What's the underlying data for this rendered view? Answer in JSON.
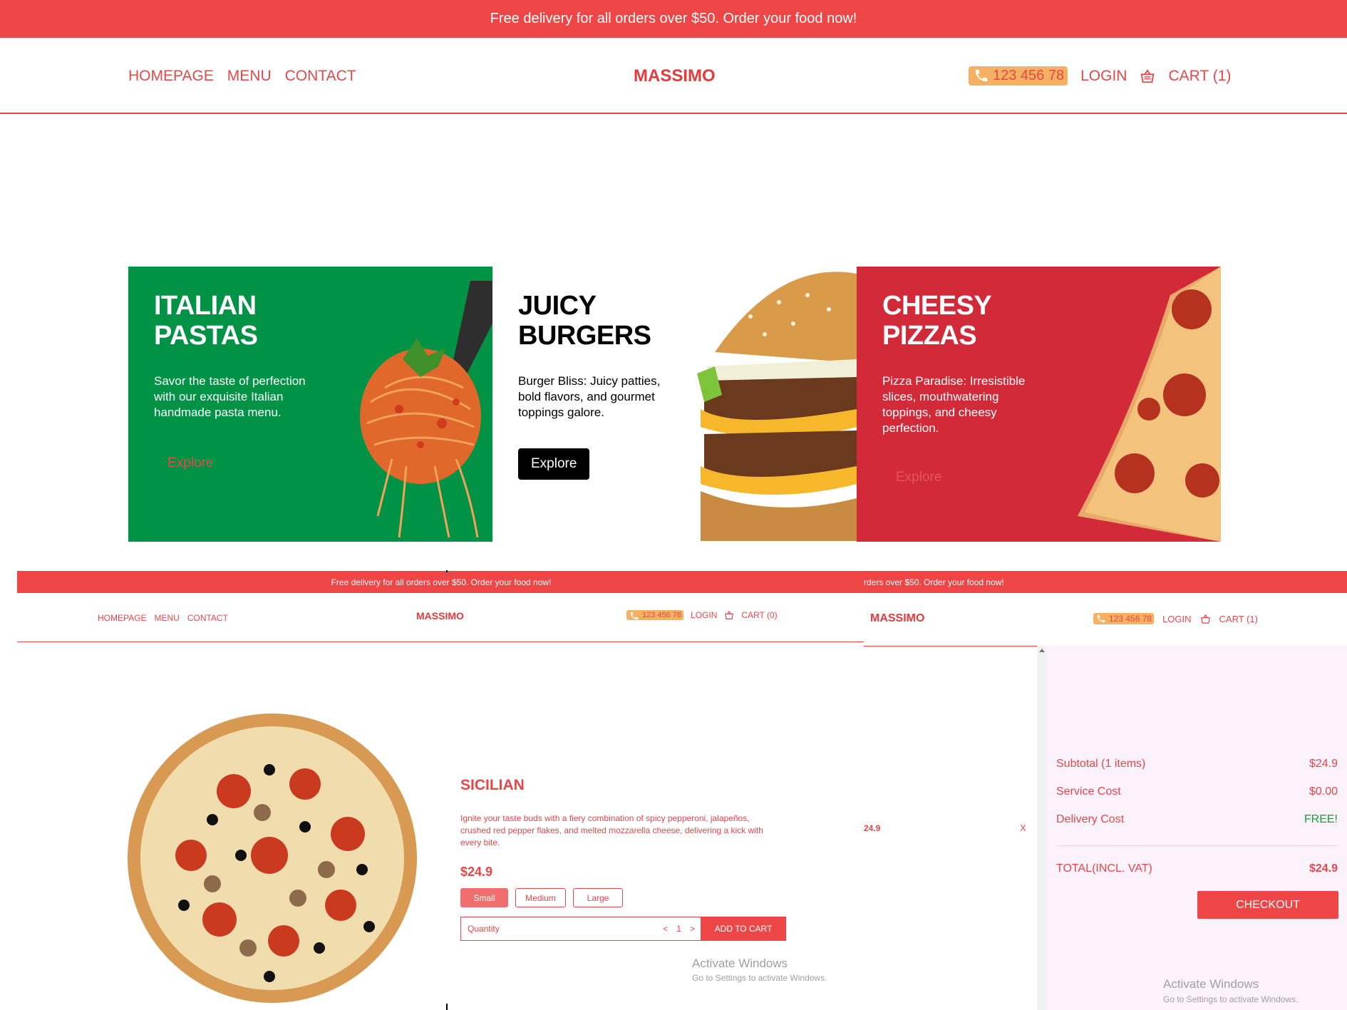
{
  "promo": {
    "text": "Free delivery for all orders over $50. Order your food now!"
  },
  "header": {
    "links": [
      "HOMEPAGE",
      "MENU",
      "CONTACT"
    ],
    "logo": "MASSIMO",
    "phone": "123 456 78",
    "login": "LOGIN",
    "cart": "CART (1)"
  },
  "hero": [
    {
      "title": "ITALIAN PASTAS",
      "text": "Savor the taste of perfection with our exquisite Italian handmade pasta menu.",
      "button": "Explore"
    },
    {
      "title": "JUICY BURGERS",
      "text": "Burger Bliss: Juicy patties, bold flavors, and gourmet toppings galore.",
      "button": "Explore"
    },
    {
      "title": "CHEESY PIZZAS",
      "text": "Pizza Paradise: Irresistible slices, mouthwatering toppings, and cheesy perfection.",
      "button": "Explore"
    }
  ],
  "product_page": {
    "promo": "Free delivery for all orders over $50. Order your food now!",
    "links": [
      "HOMEPAGE",
      "MENU",
      "CONTACT"
    ],
    "logo": "MASSIMO",
    "phone": "123 456 78",
    "login": "LOGIN",
    "cart": "CART (0)",
    "product": {
      "name": "SICILIAN",
      "description": "Ignite your taste buds with a fiery combination of spicy pepperoni, jalapeños, crushed red pepper flakes, and melted mozzarella cheese, delivering a kick with every bite.",
      "price": "$24.9",
      "sizes": [
        "Small",
        "Medium",
        "Large"
      ],
      "selected_size": "Small",
      "quantity_label": "Quantity",
      "quantity": "1",
      "dec": "<",
      "inc": ">",
      "add_to_cart": "ADD TO CART"
    },
    "watermark": {
      "title": "Activate Windows",
      "sub": "Go to Settings to activate Windows."
    }
  },
  "cart_page": {
    "promo": "rders over $50. Order your food now!",
    "logo": "MASSIMO",
    "phone": "123 456 78",
    "login": "LOGIN",
    "cart": "CART (1)",
    "item_price": "24.9",
    "remove": "X",
    "summary": {
      "subtotal_label": "Subtotal (1 items)",
      "subtotal": "$24.9",
      "service_label": "Service Cost",
      "service": "$0.00",
      "delivery_label": "Delivery Cost",
      "delivery": "FREE!",
      "total_label": "TOTAL(INCL. VAT)",
      "total": "$24.9",
      "checkout": "CHECKOUT"
    },
    "watermark": {
      "title": "Activate Windows",
      "sub": "Go to Settings to activate Windows."
    }
  },
  "colors": {
    "accent": "#ee4547",
    "phone_bg": "#f5b062",
    "green": "#009245",
    "red_card": "#d22a38",
    "panel": "#fcf2fb",
    "free": "#1a9c3a"
  }
}
